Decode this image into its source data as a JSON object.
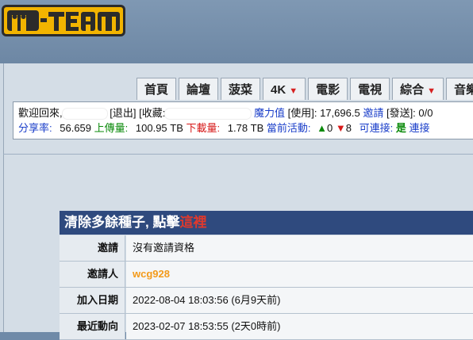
{
  "logo": {
    "text": "M-TEAM",
    "icon": "mteam-logo"
  },
  "nav": {
    "tabs": [
      {
        "label": "首頁",
        "dropdown": false
      },
      {
        "label": "論壇",
        "dropdown": false
      },
      {
        "label": "菠菜",
        "dropdown": false
      },
      {
        "label": "4K",
        "dropdown": true
      },
      {
        "label": "電影",
        "dropdown": false
      },
      {
        "label": "電視",
        "dropdown": false
      },
      {
        "label": "綜合",
        "dropdown": true
      },
      {
        "label": "音樂",
        "dropdown": false
      }
    ]
  },
  "info": {
    "welcome": "歡迎回來,",
    "logout": "[退出]",
    "favorites": "[收藏:",
    "magic_label": "魔力值",
    "used_label": "[使用]:",
    "magic_value": "17,696.5",
    "invite_link": "邀請",
    "sent_label": "[發送]: 0/0",
    "ratio_label": "分享率:",
    "ratio_value": "56.659",
    "upload_label": "上傳量:",
    "upload_value": "100.95 TB",
    "download_label": "下載量:",
    "download_value": "1.78 TB",
    "active_label": "當前活動:",
    "seeding": "0",
    "leeching": "8",
    "connectable_label": "可連接:",
    "connectable_value": "是",
    "connect_link": "連接"
  },
  "table": {
    "header_text": "清除多餘種子, 點擊",
    "header_link": "這裡",
    "rows": [
      {
        "key": "邀請",
        "value": "沒有邀請資格"
      },
      {
        "key": "邀請人",
        "value": "wcg928"
      },
      {
        "key": "加入日期",
        "value": "2022-08-04 18:03:56 (6月9天前)"
      },
      {
        "key": "最近動向",
        "value": "2023-02-07 18:53:55 (2天0時前)"
      }
    ]
  },
  "colors": {
    "header_bg": "#2f4a7e",
    "link_blue": "#1a3ec9",
    "accent_red": "#d71a1a",
    "accent_orange": "#f39a1a",
    "logo_yellow": "#f2b400"
  }
}
